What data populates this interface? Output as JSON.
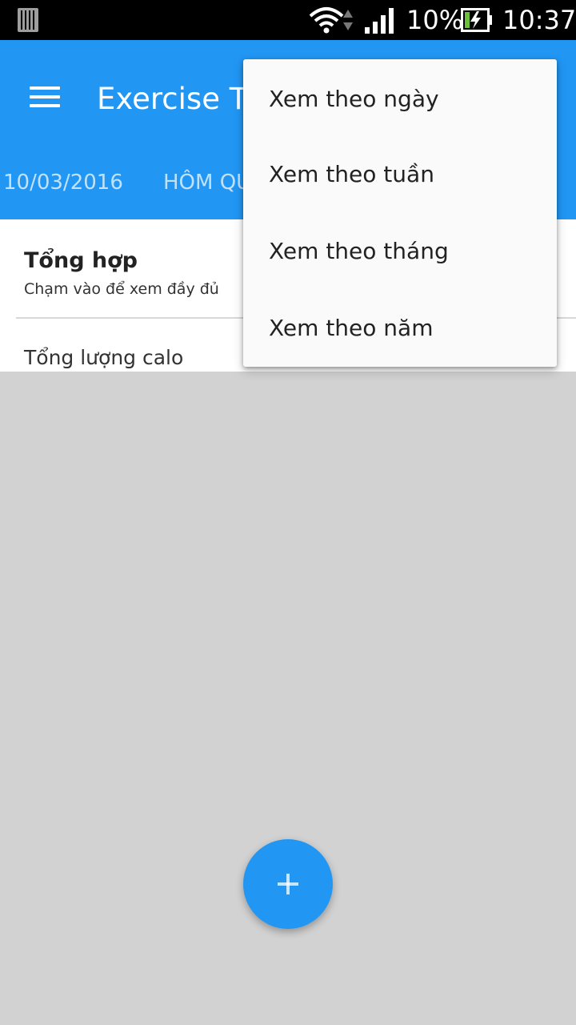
{
  "status_bar": {
    "battery_percent": "10%",
    "time": "10:37",
    "icons": [
      "notification-icon",
      "wifi-icon",
      "data-activity-icon",
      "signal-icon",
      "battery-charging-icon"
    ]
  },
  "app_bar": {
    "title": "Exercise T",
    "tabs": [
      {
        "label": "10/03/2016"
      },
      {
        "label": "HÔM QU"
      }
    ],
    "background_color": "#2196f3"
  },
  "content": {
    "summary_title": "Tổng hợp",
    "summary_subtitle": "Chạm vào để xem đầy đủ",
    "calo_label": "Tổng lượng calo"
  },
  "popup_menu": {
    "items": [
      {
        "label": "Xem theo ngày"
      },
      {
        "label": "Xem theo tuần"
      },
      {
        "label": "Xem theo tháng"
      },
      {
        "label": "Xem theo năm"
      }
    ]
  },
  "fab": {
    "icon": "plus-icon",
    "color": "#2196f3"
  }
}
